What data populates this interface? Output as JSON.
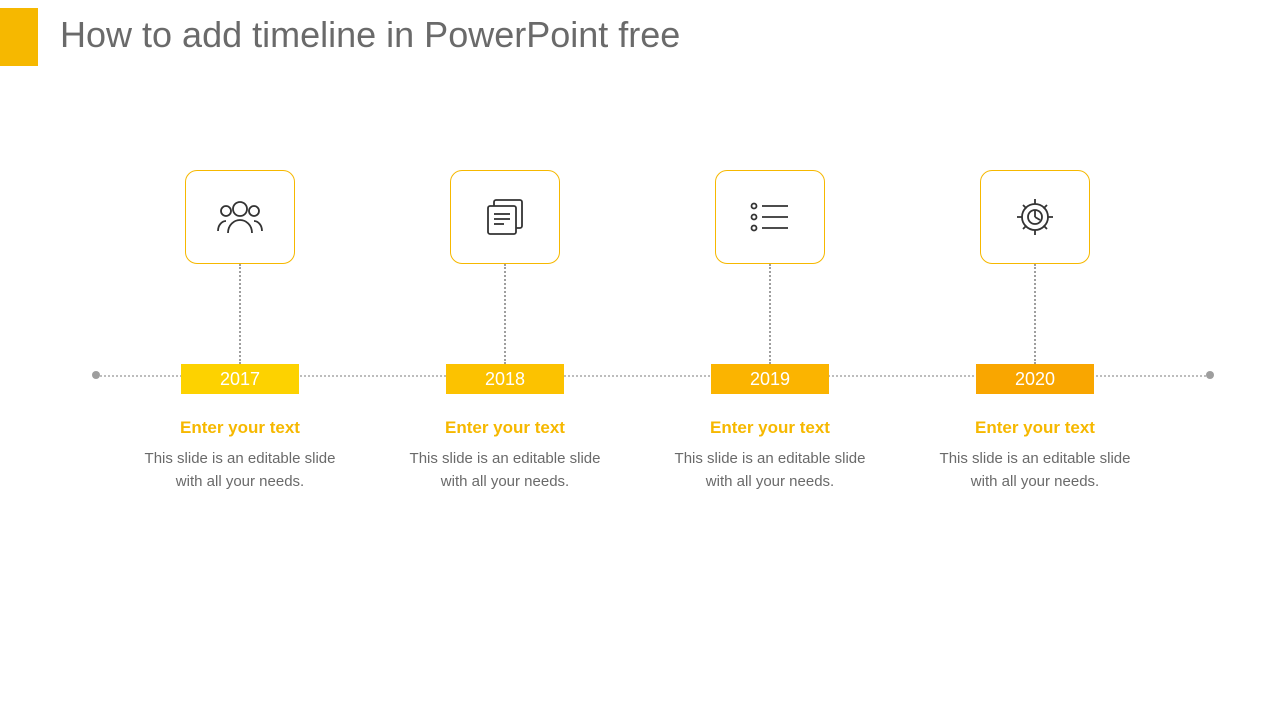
{
  "title": "How to add timeline in PowerPoint free",
  "items": [
    {
      "year": "2017",
      "heading": "Enter your text",
      "body": "This slide is an editable slide with all your needs.",
      "icon": "people-icon"
    },
    {
      "year": "2018",
      "heading": "Enter your text",
      "body": "This slide is an editable slide with all your needs.",
      "icon": "document-icon"
    },
    {
      "year": "2019",
      "heading": "Enter your text",
      "body": "This slide is an editable slide with all your needs.",
      "icon": "list-icon"
    },
    {
      "year": "2020",
      "heading": "Enter your text",
      "body": "This slide is an editable slide with all your needs.",
      "icon": "gear-icon"
    }
  ]
}
